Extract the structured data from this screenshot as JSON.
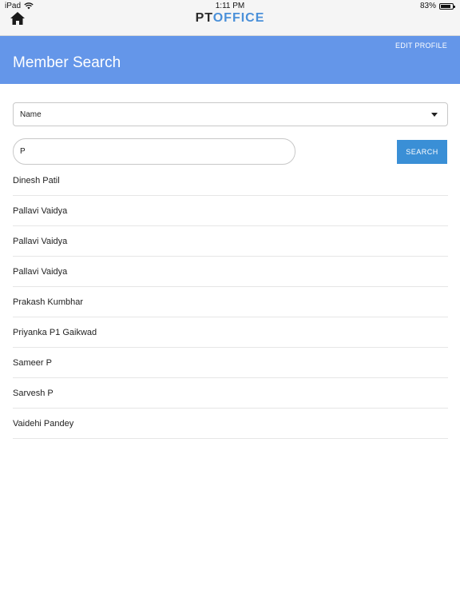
{
  "status_bar": {
    "device": "iPad",
    "time": "1:11 PM",
    "battery_percent": "83%",
    "battery_level": 0.83
  },
  "nav": {
    "home_icon": "home-icon",
    "logo_pt": "PT",
    "logo_office": "OFFICE"
  },
  "header": {
    "title": "Member Search",
    "edit_profile_label": "EDIT PROFILE",
    "color": "#6496e9"
  },
  "search": {
    "field_select_value": "Name",
    "query_value": "P",
    "button_label": "SEARCH",
    "button_color": "#3a8fd6"
  },
  "results": [
    "Dinesh Patil",
    "Pallavi Vaidya",
    "Pallavi Vaidya",
    "Pallavi Vaidya",
    "Prakash Kumbhar",
    "Priyanka P1 Gaikwad",
    "Sameer P",
    "Sarvesh P",
    "Vaidehi Pandey"
  ]
}
